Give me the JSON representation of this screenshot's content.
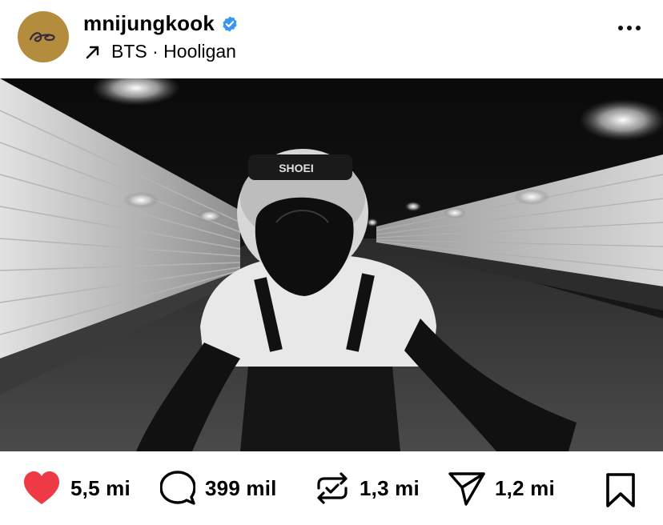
{
  "post": {
    "username": "mnijungkook",
    "verified": true,
    "audio_track": "BTS · Hooligan"
  },
  "media": {
    "type": "video",
    "muted": true,
    "style": "black-and-white"
  },
  "actions": {
    "likes": "5,5 mi",
    "comments": "399 mil",
    "reposts": "1,3 mi",
    "shares": "1,2 mi"
  },
  "icons": {
    "avatar": "signature-logo",
    "verified": "verified-badge-icon",
    "audio": "trending-arrow-icon",
    "more": "more-options-icon",
    "mute": "speaker-muted-icon",
    "like": "heart-icon",
    "comment": "comment-bubble-icon",
    "repost": "repost-icon",
    "share": "send-icon",
    "save": "bookmark-icon"
  },
  "colors": {
    "like": "#ed3a45",
    "verified": "#3897f0",
    "avatar_bg": "#b38d3d",
    "text": "#000000"
  }
}
